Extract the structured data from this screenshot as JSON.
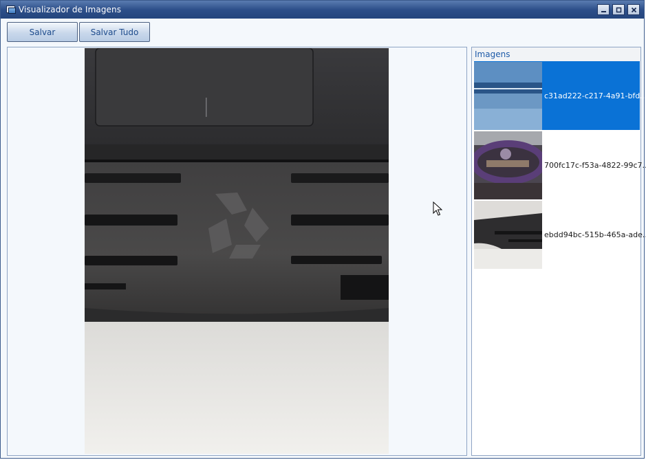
{
  "window": {
    "title": "Visualizador de Imagens",
    "controls": {
      "minimize_icon": "minimize-icon",
      "maximize_icon": "maximize-icon",
      "close_icon": "close-icon"
    }
  },
  "toolbar": {
    "save_label": "Salvar",
    "save_all_label": "Salvar Tudo"
  },
  "side_panel": {
    "header": "Imagens",
    "items": [
      {
        "label": "c31ad222-c217-4a91-bfd...",
        "selected": true
      },
      {
        "label": "700fc17c-f53a-4822-99c7...",
        "selected": false
      },
      {
        "label": "ebdd94bc-515b-465a-ade...",
        "selected": false
      }
    ]
  },
  "colors": {
    "selection": "#0a72d6",
    "title_bar": "#2d4f8a",
    "accent_text": "#1d5aa8"
  }
}
